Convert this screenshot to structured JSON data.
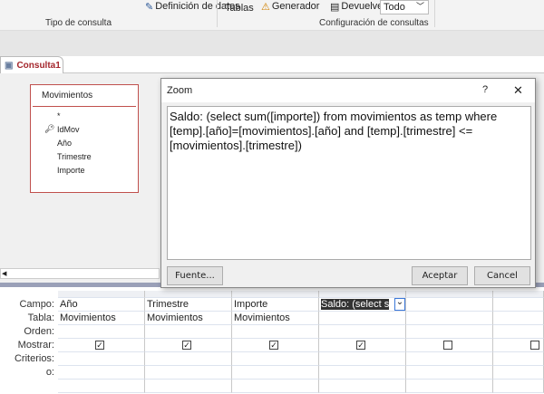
{
  "ribbon": {
    "data_definition": "Definición de datos",
    "tables": "Tablas",
    "builder": "Generador",
    "returns_label": "Devuelve:",
    "returns_value": "Todo",
    "group_query_type": "Tipo de consulta",
    "group_query_setup": "Configuración de consultas"
  },
  "tab": {
    "label": "Consulta1"
  },
  "table": {
    "name": "Movimientos",
    "fields": [
      "*",
      "IdMov",
      "Año",
      "Trimestre",
      "Importe"
    ]
  },
  "dialog": {
    "title": "Zoom",
    "help": "?",
    "close": "✕",
    "text": "Saldo: (select sum([importe]) from movimientos as temp where [temp].[año]=[movimientos].[año] and [temp].[trimestre] <=[movimientos].[trimestre])",
    "font_button": "Fuente...",
    "ok_button": "Aceptar",
    "cancel_button": "Cancel"
  },
  "grid": {
    "row_labels": [
      "Campo:",
      "Tabla:",
      "Orden:",
      "Mostrar:",
      "Criterios:",
      "o:"
    ],
    "columns": [
      {
        "field": "Año",
        "table": "Movimientos",
        "show": true
      },
      {
        "field": "Trimestre",
        "table": "Movimientos",
        "show": true
      },
      {
        "field": "Importe",
        "table": "Movimientos",
        "show": true
      },
      {
        "field": "Saldo: (select s",
        "table": "",
        "show": true
      },
      {
        "field": "",
        "table": "",
        "show": false
      },
      {
        "field": "",
        "table": "",
        "show": false
      }
    ]
  }
}
